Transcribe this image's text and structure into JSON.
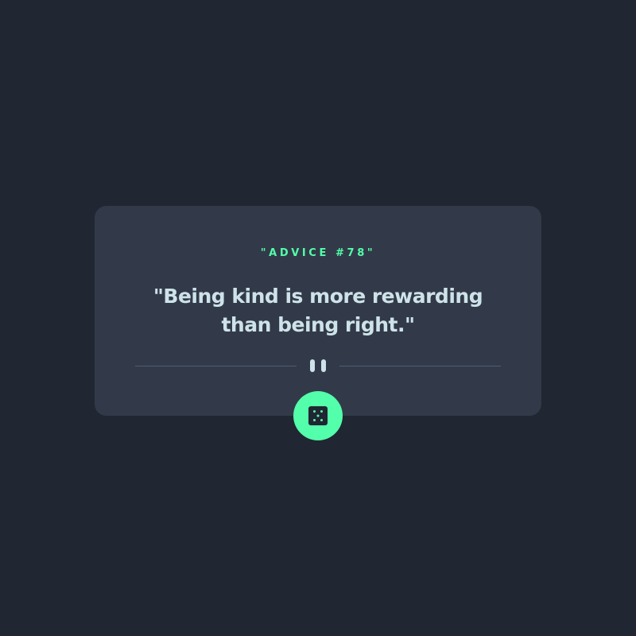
{
  "card": {
    "advice_label": "\"ADVICE #78\"",
    "quote": "\"Being kind is more rewarding than being right.\""
  },
  "icons": {
    "divider": "pause-icon",
    "button": "dice-icon"
  },
  "colors": {
    "background": "#202632",
    "card": "#323a49",
    "accent": "#53ffaa",
    "text": "#cee3e9",
    "divider": "#4f5d74"
  }
}
